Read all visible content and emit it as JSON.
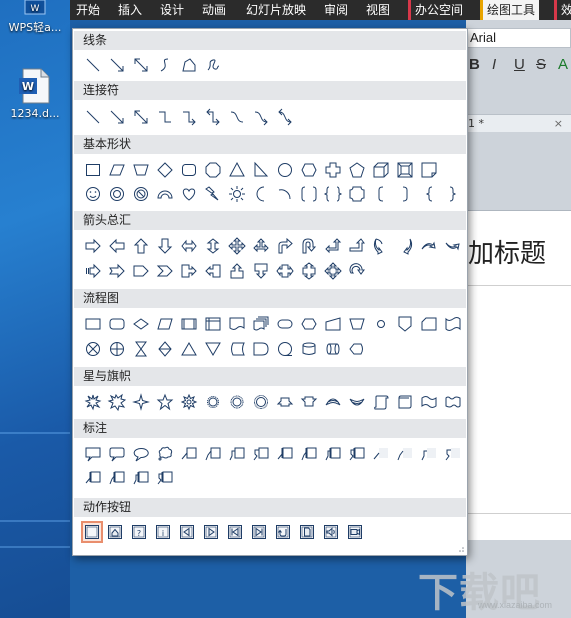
{
  "desktop": {
    "icons": [
      {
        "label": "WPS轻a...",
        "icon": "wps-app-icon"
      },
      {
        "label": "1234.d...",
        "icon": "word-document-icon"
      }
    ]
  },
  "ribbon": {
    "tabs": [
      "开始",
      "插入",
      "设计",
      "动画",
      "幻灯片放映",
      "审阅",
      "视图",
      "办公空间",
      "绘图工具",
      "效"
    ],
    "active_tab": "绘图工具"
  },
  "app": {
    "font_name": "Arial",
    "format_buttons": [
      "B",
      "I",
      "U",
      "S",
      "A"
    ],
    "doc_tab": "1 *",
    "doc_tab_close": "×",
    "slide_title": "加标题"
  },
  "watermark": {
    "text": "下载吧",
    "url": "www.xiazaiba.com"
  },
  "panel": {
    "sections": [
      {
        "title": "线条",
        "shapes": [
          "line",
          "arrow-line",
          "double-arrow-line",
          "curve",
          "freeform",
          "scribble"
        ]
      },
      {
        "title": "连接符",
        "shapes": [
          "straight-connector",
          "straight-arrow-connector",
          "double-arrow-connector",
          "elbow-connector",
          "elbow-arrow-connector",
          "elbow-double-arrow-connector",
          "curved-connector",
          "curved-arrow-connector",
          "curved-double-arrow-connector"
        ]
      },
      {
        "title": "基本形状",
        "shapes": [
          "rectangle",
          "parallelogram",
          "trapezoid",
          "diamond",
          "rounded-rectangle",
          "octagon",
          "triangle",
          "right-triangle",
          "ellipse",
          "hexagon",
          "cross",
          "pentagon",
          "cube",
          "bevel",
          "folded-corner",
          "smiley",
          "donut",
          "no-symbol",
          "block-arc",
          "heart",
          "lightning",
          "sun",
          "moon",
          "arc",
          "double-bracket",
          "double-brace",
          "plaque",
          "left-bracket",
          "right-bracket",
          "left-brace",
          "right-brace"
        ]
      },
      {
        "title": "箭头总汇",
        "shapes": [
          "right-arrow",
          "left-arrow",
          "up-arrow",
          "down-arrow",
          "left-right-arrow",
          "up-down-arrow",
          "quad-arrow",
          "left-right-up-arrow",
          "bent-arrow",
          "u-turn-arrow",
          "left-up-arrow",
          "bent-up-arrow",
          "curved-right-arrow",
          "curved-left-arrow",
          "curved-up-arrow",
          "curved-down-arrow",
          "striped-right-arrow",
          "notched-right-arrow",
          "pentagon-arrow",
          "chevron",
          "right-arrow-callout",
          "left-arrow-callout",
          "up-arrow-callout",
          "down-arrow-callout",
          "left-right-arrow-callout",
          "up-down-arrow-callout",
          "quad-arrow-callout",
          "circular-arrow"
        ]
      },
      {
        "title": "流程图",
        "shapes": [
          "process",
          "alternate-process",
          "decision",
          "data",
          "predefined-process",
          "internal-storage",
          "document",
          "multidocument",
          "terminator",
          "preparation",
          "manual-input",
          "manual-operation",
          "connector",
          "off-page-connector",
          "card",
          "punched-tape",
          "summing-junction",
          "or",
          "collate",
          "sort",
          "extract",
          "merge",
          "stored-data",
          "delay",
          "sequential-access",
          "magnetic-disk",
          "direct-access",
          "display"
        ]
      },
      {
        "title": "星与旗帜",
        "shapes": [
          "explosion-1",
          "explosion-2",
          "4-point-star",
          "5-point-star",
          "8-point-star",
          "16-point-star",
          "24-point-star",
          "32-point-star",
          "up-ribbon",
          "down-ribbon",
          "curved-up-ribbon",
          "curved-down-ribbon",
          "vertical-scroll",
          "horizontal-scroll",
          "wave",
          "double-wave"
        ]
      },
      {
        "title": "标注",
        "shapes": [
          "rectangular-callout",
          "rounded-rectangular-callout",
          "oval-callout",
          "cloud-callout",
          "line-callout-1",
          "line-callout-2",
          "line-callout-3",
          "line-callout-4",
          "line-callout-1-accent",
          "line-callout-2-accent",
          "line-callout-3-accent",
          "line-callout-4-accent",
          "line-callout-1-no-border",
          "line-callout-2-no-border",
          "line-callout-3-no-border",
          "line-callout-4-no-border",
          "line-callout-1-border-accent",
          "line-callout-2-border-accent",
          "line-callout-3-border-accent",
          "line-callout-4-border-accent"
        ]
      },
      {
        "title": "动作按钮",
        "shapes": [
          "action-button-custom",
          "action-button-home",
          "action-button-help",
          "action-button-information",
          "action-button-back",
          "action-button-forward",
          "action-button-beginning",
          "action-button-end",
          "action-button-return",
          "action-button-document",
          "action-button-sound",
          "action-button-movie"
        ]
      }
    ]
  },
  "colors": {
    "shape_stroke": "#1f3d66",
    "shape_fill": "#ffffff",
    "selected_border": "#e98e6d",
    "section_bg": "#e4e6e9",
    "active_tab_accent": "#e8a400",
    "office_tab_accent": "#d7384a"
  }
}
